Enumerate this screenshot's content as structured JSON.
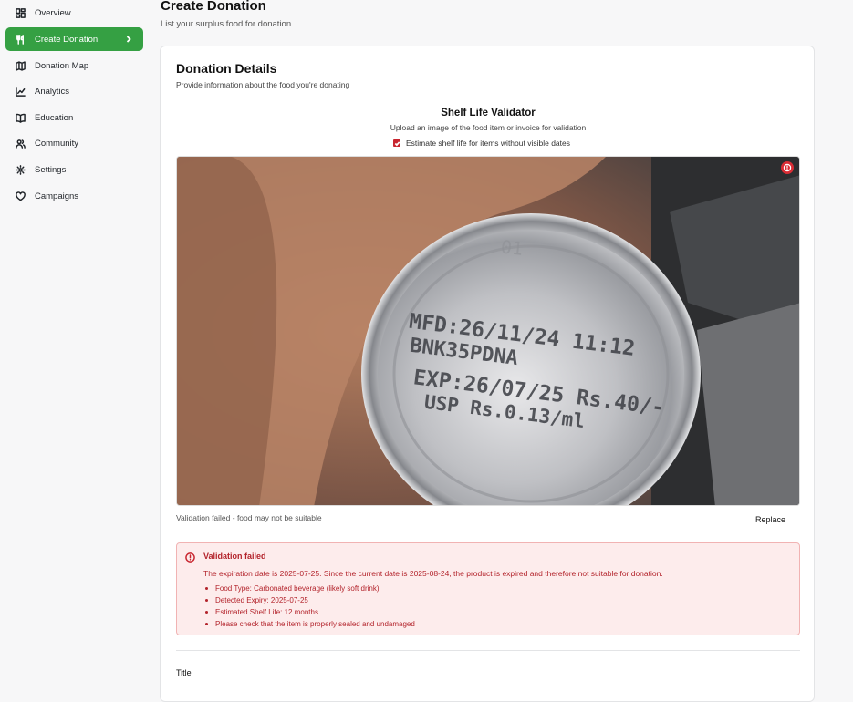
{
  "sidebar": {
    "items": [
      {
        "label": "Overview",
        "icon": "dashboard-icon"
      },
      {
        "label": "Create Donation",
        "icon": "utensils-icon",
        "active": true
      },
      {
        "label": "Donation Map",
        "icon": "map-icon"
      },
      {
        "label": "Analytics",
        "icon": "line-chart-icon"
      },
      {
        "label": "Education",
        "icon": "book-icon"
      },
      {
        "label": "Community",
        "icon": "users-icon"
      },
      {
        "label": "Settings",
        "icon": "gear-icon"
      },
      {
        "label": "Campaigns",
        "icon": "heart-icon"
      }
    ]
  },
  "header": {
    "title": "Create Donation",
    "subtitle": "List your surplus food for donation"
  },
  "details": {
    "title": "Donation Details",
    "subtitle": "Provide information about the food you're donating"
  },
  "validator": {
    "title": "Shelf Life Validator",
    "subtitle": "Upload an image of the food item or invoice for validation",
    "checkbox_label": "Estimate shelf life for items without visible dates",
    "checkbox_checked": true,
    "image_print": {
      "line1": "MFD:26/11/24 11:12",
      "line2": "BNK35PDNA",
      "line3": "EXP:26/07/25 Rs.40/-",
      "line4": "USP Rs.0.13/ml"
    },
    "status_text": "Validation failed - food may not be suitable",
    "replace_label": "Replace"
  },
  "alert": {
    "title": "Validation failed",
    "message": "The expiration date is 2025-07-25. Since the current date is 2025-08-24, the product is expired and therefore not suitable for donation.",
    "items": [
      "Food Type: Carbonated beverage (likely soft drink)",
      "Detected Expiry: 2025-07-25",
      "Estimated Shelf Life: 12 months",
      "Please check that the item is properly sealed and undamaged"
    ]
  },
  "form": {
    "title_label": "Title"
  },
  "colors": {
    "accent": "#35a043",
    "error": "#c8252f",
    "error_bg": "#fdecec"
  }
}
